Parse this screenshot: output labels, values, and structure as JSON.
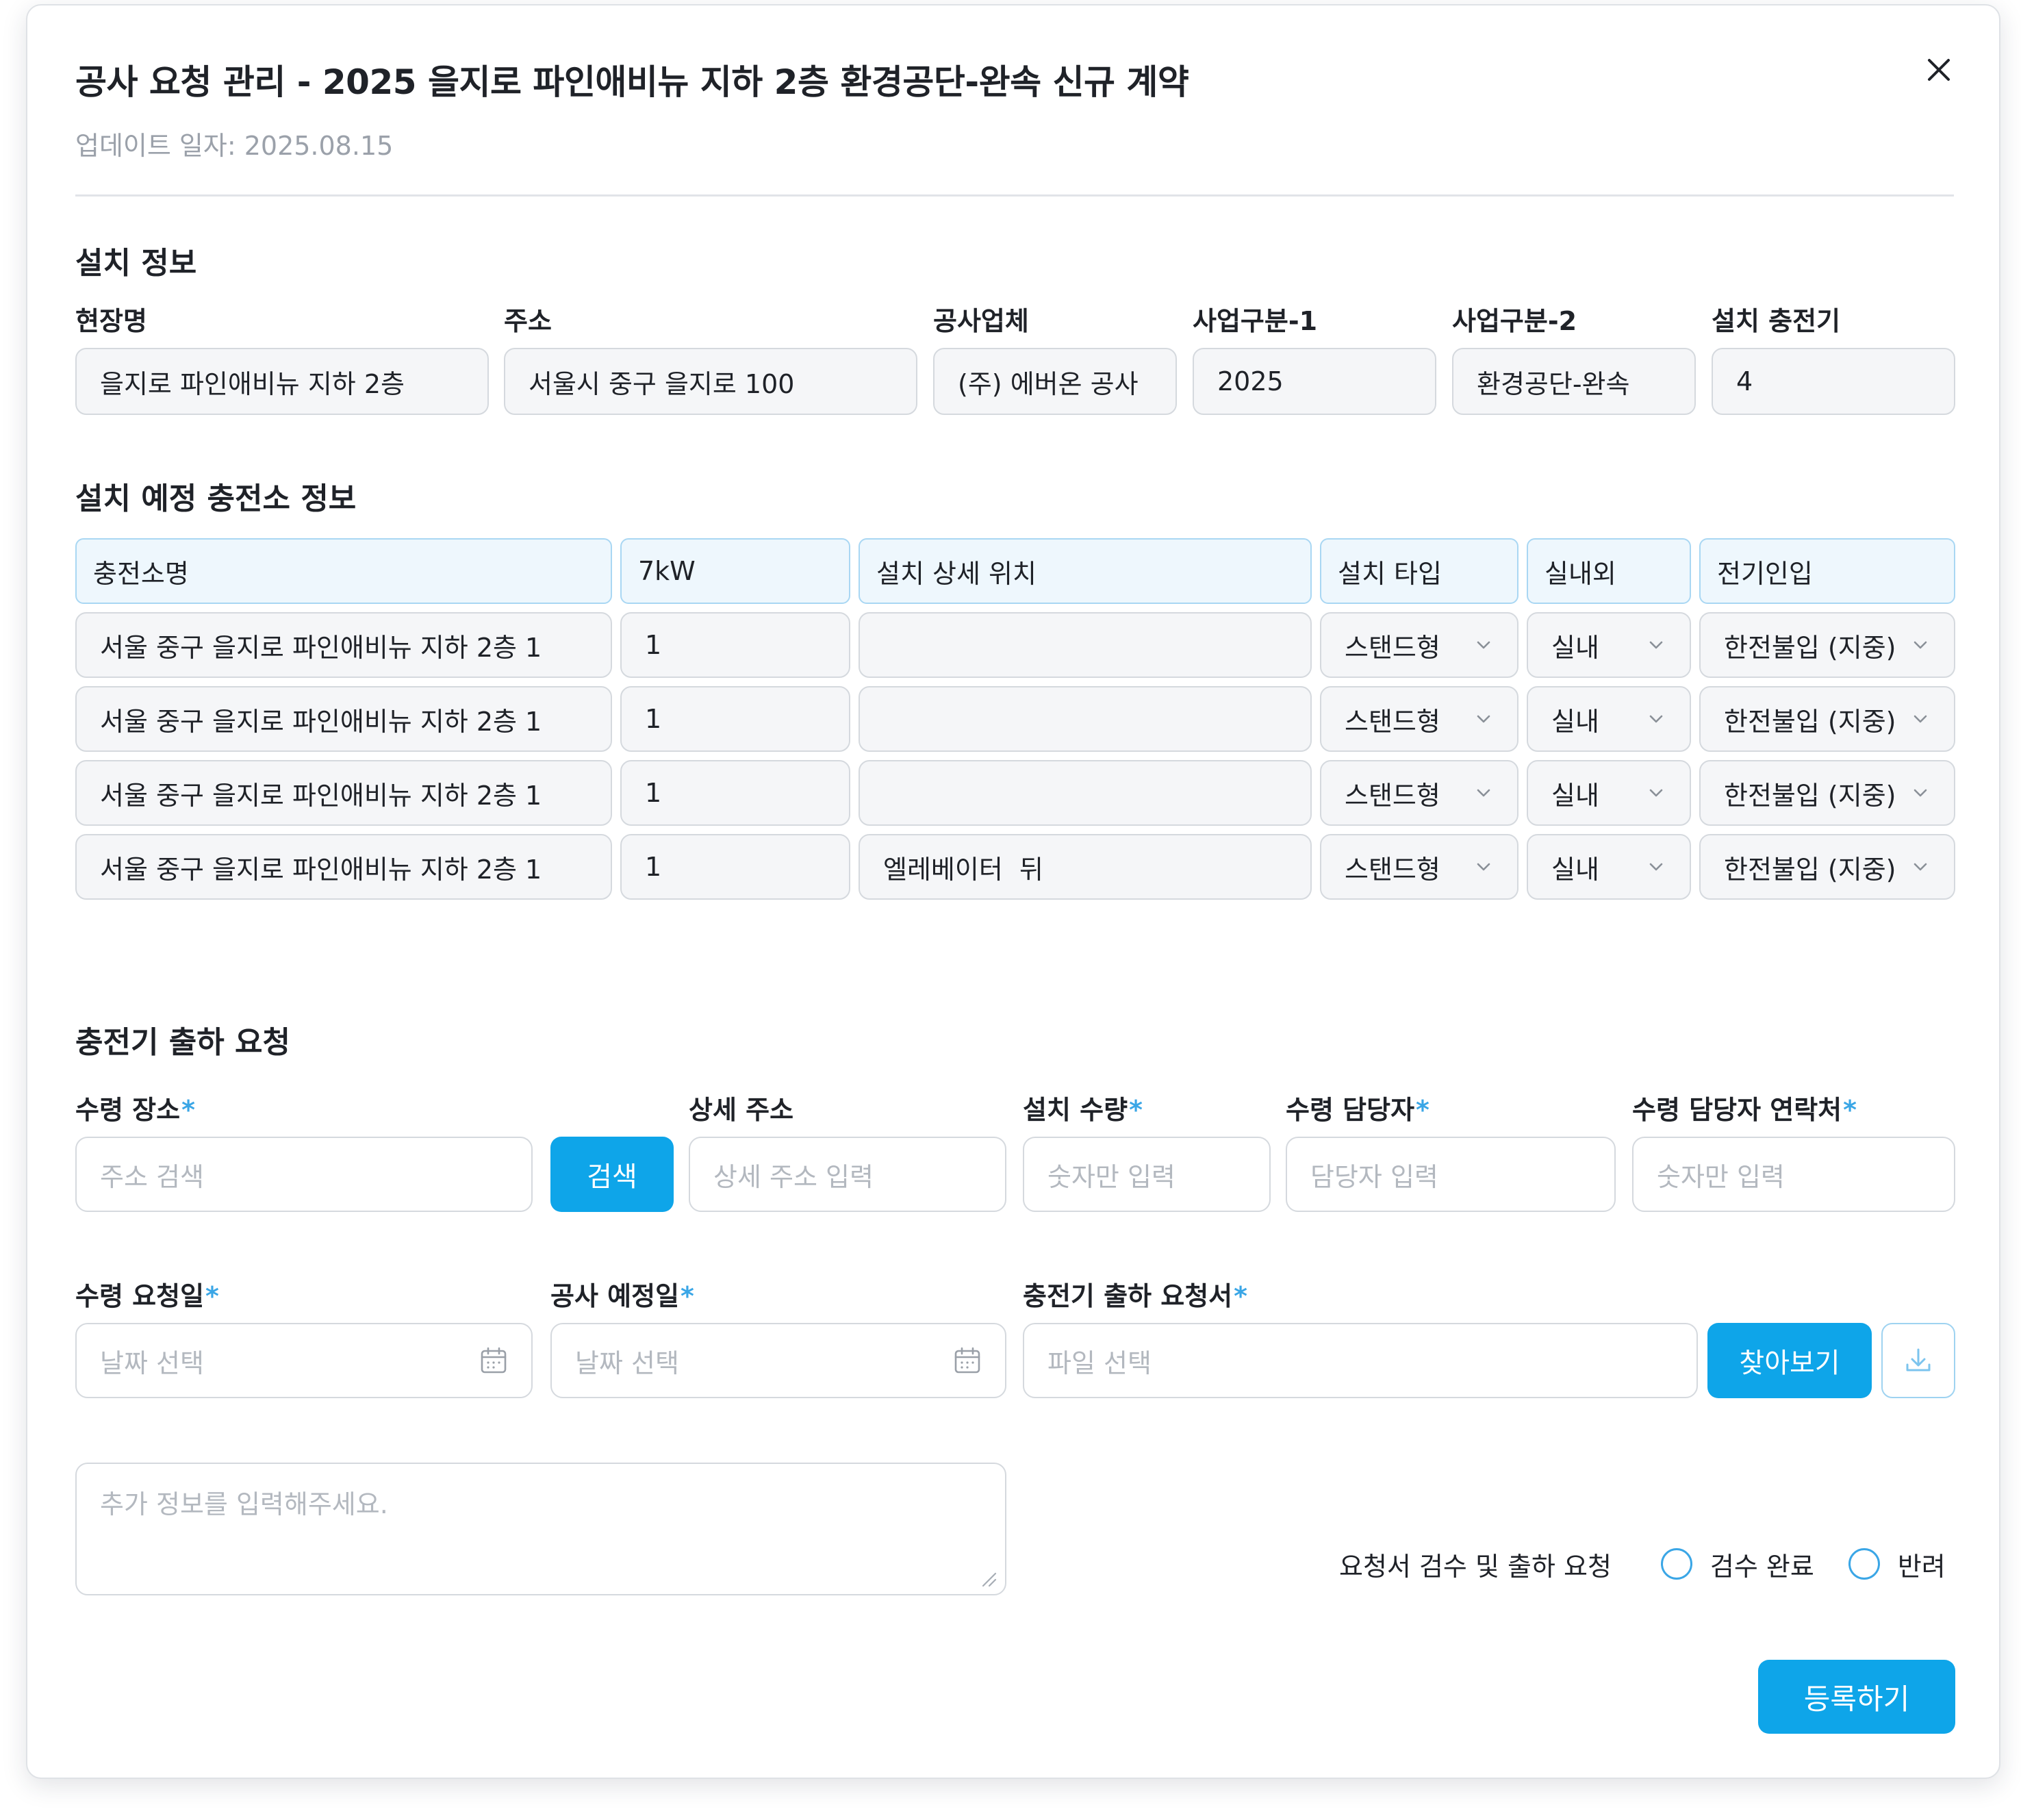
{
  "modal": {
    "title": "공사 요청 관리 - 2025 을지로 파인애비뉴 지하 2층 환경공단-완속 신규 계약",
    "subtitle": "업데이트 일자: 2025.08.15",
    "close_icon": "close-icon"
  },
  "install_info": {
    "section_title": "설치 정보",
    "fields": [
      {
        "label": "현장명",
        "value": "을지로 파인애비뉴 지하 2층"
      },
      {
        "label": "주소",
        "value": "서울시 중구 을지로 100"
      },
      {
        "label": "공사업체",
        "value": "(주) 에버온 공사"
      },
      {
        "label": "사업구분-1",
        "value": "2025"
      },
      {
        "label": "사업구분-2",
        "value": "환경공단-완속"
      },
      {
        "label": "설치 충전기",
        "value": "4"
      }
    ]
  },
  "stations": {
    "section_title": "설치 예정 충전소 정보",
    "headers": [
      "충전소명",
      "7kW",
      "설치 상세 위치",
      "설치 타입",
      "실내외",
      "전기인입"
    ],
    "rows": [
      {
        "name": "서울 중구 을지로 파인애비뉴 지하 2층 1",
        "kw": "1",
        "location": "",
        "type": "스탠드형",
        "inout": "실내",
        "power": "한전불입 (지중)"
      },
      {
        "name": "서울 중구 을지로 파인애비뉴 지하 2층 1",
        "kw": "1",
        "location": "",
        "type": "스탠드형",
        "inout": "실내",
        "power": "한전불입 (지중)"
      },
      {
        "name": "서울 중구 을지로 파인애비뉴 지하 2층 1",
        "kw": "1",
        "location": "",
        "type": "스탠드형",
        "inout": "실내",
        "power": "한전불입 (지중)"
      },
      {
        "name": "서울 중구 을지로 파인애비뉴 지하 2층 1",
        "kw": "1",
        "location": "엘레베이터  뒤",
        "type": "스탠드형",
        "inout": "실내",
        "power": "한전불입 (지중)"
      }
    ]
  },
  "shipping": {
    "section_title": "충전기 출하 요청",
    "required_mark": "*",
    "receive_place": {
      "label": "수령 장소",
      "placeholder": "주소 검색",
      "button": "검색"
    },
    "detail_address": {
      "label": "상세 주소",
      "placeholder": "상세 주소 입력"
    },
    "install_qty": {
      "label": "설치 수량",
      "placeholder": "숫자만 입력"
    },
    "receiver": {
      "label": "수령 담당자",
      "placeholder": "담당자 입력"
    },
    "receiver_contact": {
      "label": "수령 담당자 연락처",
      "placeholder": "숫자만 입력"
    },
    "receive_date": {
      "label": "수령 요청일",
      "placeholder": "날짜 선택"
    },
    "construction_date": {
      "label": "공사 예정일",
      "placeholder": "날짜 선택"
    },
    "request_doc": {
      "label": "충전기 출하 요청서",
      "placeholder": "파일 선택",
      "browse_button": "찾아보기"
    },
    "extra_info": {
      "placeholder": "추가 정보를 입력해주세요."
    },
    "review": {
      "label": "요청서 검수 및 출하 요청",
      "options": [
        "검수 완료",
        "반려"
      ]
    },
    "submit": "등록하기"
  },
  "colors": {
    "accent": "#0ea5e9",
    "required": "#3aa6e6",
    "header_bg": "#eef7fd",
    "header_border": "#a9d7f3"
  }
}
